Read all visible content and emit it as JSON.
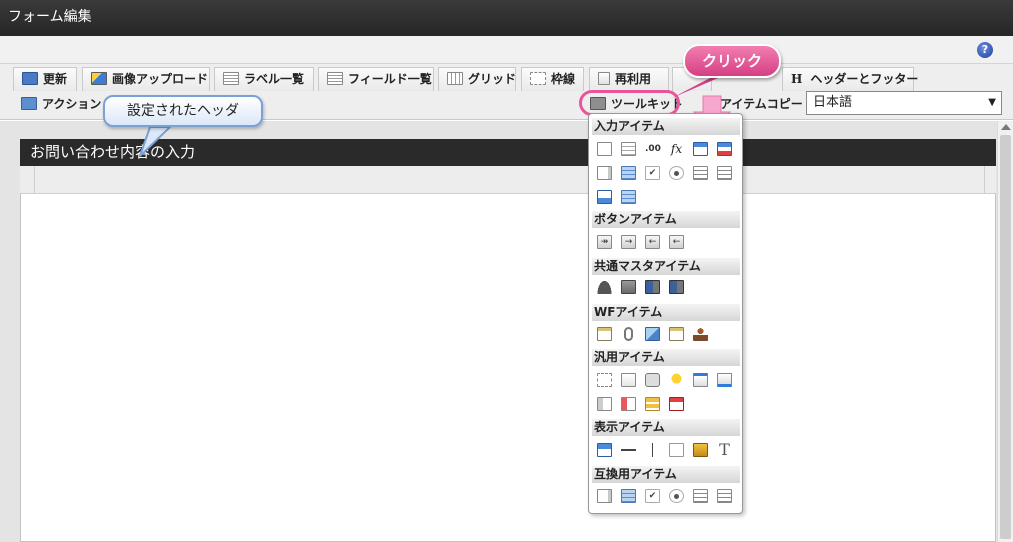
{
  "window": {
    "title": "フォーム編集"
  },
  "help": {
    "icon_label": "?"
  },
  "toolbar": {
    "update": "更新",
    "image_upload": "画像アップロード",
    "label_list": "ラベル一覧",
    "field_list": "フィールド一覧",
    "grid": "グリッド",
    "border": "枠線",
    "reuse": "再利用",
    "header_footer": "ヘッダーとフッター",
    "header_footer_prefix": "H",
    "action": "アクション設定",
    "action_visible": "アクション",
    "toolkit": "ツールキット",
    "item_copy": "アイテムコピー"
  },
  "language": {
    "selected": "日本語"
  },
  "callouts": {
    "header_set": "設定されたヘッダ",
    "click": "クリック"
  },
  "form": {
    "header_title": "お問い合わせ内容の入力"
  },
  "toolkit": {
    "sections": [
      {
        "title": "入力アイテム",
        "icons": [
          "textbox-icon",
          "textarea-icon",
          "number-icon",
          "formula-icon",
          "date-icon",
          "datetime-icon",
          "select-icon",
          "table-icon",
          "checkbox-icon",
          "radio-icon",
          "listbox-icon",
          "listbox2-icon",
          "file-upload-icon",
          "grid-table-icon"
        ]
      },
      {
        "title": "ボタンアイテム",
        "icons": [
          "submit-button-icon",
          "next-button-icon",
          "back-button-icon",
          "back2-button-icon"
        ]
      },
      {
        "title": "共通マスタアイテム",
        "icons": [
          "user-icon",
          "company-icon",
          "organization-icon",
          "organization2-icon"
        ]
      },
      {
        "title": "WFアイテム",
        "icons": [
          "clipboard-icon",
          "attach-icon",
          "image-icon",
          "history-icon",
          "stamp-icon"
        ]
      },
      {
        "title": "汎用アイテム",
        "icons": [
          "dashed-box-icon",
          "document-icon",
          "camera-icon",
          "bulb-icon",
          "upload-file-icon",
          "download-file-icon",
          "panel-icon",
          "card-icon",
          "tree-icon",
          "calendar-icon"
        ]
      },
      {
        "title": "表示アイテム",
        "icons": [
          "label-icon",
          "horizontal-line-icon",
          "vertical-line-icon",
          "box-icon",
          "picture-icon",
          "text-T-icon"
        ]
      },
      {
        "title": "互換用アイテム",
        "icons": [
          "select-icon",
          "table-icon",
          "checkbox-icon",
          "radio-icon",
          "listbox-icon",
          "listbox2-icon"
        ]
      }
    ]
  },
  "icon_glyphs": {
    "number": ".00",
    "formula": "fx",
    "check": "✔",
    "T": "T",
    "next": "→",
    "back": "←",
    "submit": "↠",
    "arrow_down": "▼"
  }
}
